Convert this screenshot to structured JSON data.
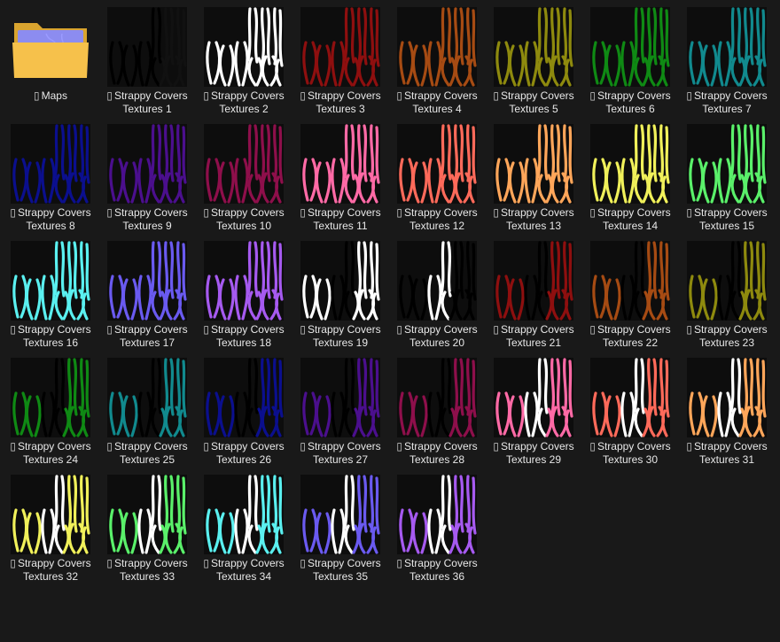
{
  "view": {
    "background": "#191919",
    "text_color": "#e8e8e8"
  },
  "items": [
    {
      "type": "folder",
      "icon": "folder-icon",
      "lines": [
        "Maps"
      ],
      "pin": "▯",
      "colors": {
        "folder": "#f6c14b",
        "paper": "#8c8cf0",
        "accent": "#9b9bff"
      }
    },
    {
      "type": "texture",
      "lines": [
        "Strappy Covers",
        "Textures 1"
      ],
      "pin": "▯",
      "colors": [
        "#000000",
        "#000000",
        "#111111"
      ]
    },
    {
      "type": "texture",
      "lines": [
        "Strappy Covers",
        "Textures 2"
      ],
      "pin": "▯",
      "colors": [
        "#ffffff",
        "#ffffff",
        "#ffffff"
      ]
    },
    {
      "type": "texture",
      "lines": [
        "Strappy Covers",
        "Textures 3"
      ],
      "pin": "▯",
      "colors": [
        "#8e0f0f",
        "#8e0f0f",
        "#8e0f0f"
      ]
    },
    {
      "type": "texture",
      "lines": [
        "Strappy Covers",
        "Textures 4"
      ],
      "pin": "▯",
      "colors": [
        "#a64b13",
        "#a64b13",
        "#a64b13"
      ]
    },
    {
      "type": "texture",
      "lines": [
        "Strappy Covers",
        "Textures 5"
      ],
      "pin": "▯",
      "colors": [
        "#8e8a0e",
        "#8e8a0e",
        "#8e8a0e"
      ]
    },
    {
      "type": "texture",
      "lines": [
        "Strappy Covers",
        "Textures 6"
      ],
      "pin": "▯",
      "colors": [
        "#0f8a14",
        "#0f8a14",
        "#0f8a14"
      ]
    },
    {
      "type": "texture",
      "lines": [
        "Strappy Covers",
        "Textures 7"
      ],
      "pin": "▯",
      "colors": [
        "#118a8e",
        "#118a8e",
        "#118a8e"
      ]
    },
    {
      "type": "texture",
      "lines": [
        "Strappy Covers",
        "Textures 8"
      ],
      "pin": "▯",
      "colors": [
        "#0b0f8e",
        "#0b0f8e",
        "#0b0f8e"
      ]
    },
    {
      "type": "texture",
      "lines": [
        "Strappy Covers",
        "Textures 9"
      ],
      "pin": "▯",
      "colors": [
        "#4b0f8e",
        "#4b0f8e",
        "#4b0f8e"
      ]
    },
    {
      "type": "texture",
      "lines": [
        "Strappy Covers",
        "Textures 10"
      ],
      "pin": "▯",
      "colors": [
        "#8e0f4b",
        "#8e0f4b",
        "#8e0f4b"
      ]
    },
    {
      "type": "texture",
      "lines": [
        "Strappy Covers",
        "Textures 11"
      ],
      "pin": "▯",
      "colors": [
        "#ff6aa6",
        "#ff6aa6",
        "#ff6aa6"
      ]
    },
    {
      "type": "texture",
      "lines": [
        "Strappy Covers",
        "Textures 12"
      ],
      "pin": "▯",
      "colors": [
        "#ff6a5a",
        "#ff6a5a",
        "#ff6a5a"
      ]
    },
    {
      "type": "texture",
      "lines": [
        "Strappy Covers",
        "Textures 13"
      ],
      "pin": "▯",
      "colors": [
        "#ffa65a",
        "#ffa65a",
        "#ffa65a"
      ]
    },
    {
      "type": "texture",
      "lines": [
        "Strappy Covers",
        "Textures 14"
      ],
      "pin": "▯",
      "colors": [
        "#f0f05a",
        "#f0f05a",
        "#f0f05a"
      ]
    },
    {
      "type": "texture",
      "lines": [
        "Strappy Covers",
        "Textures 15"
      ],
      "pin": "▯",
      "colors": [
        "#5af06a",
        "#5af06a",
        "#5af06a"
      ]
    },
    {
      "type": "texture",
      "lines": [
        "Strappy Covers",
        "Textures 16"
      ],
      "pin": "▯",
      "colors": [
        "#5af0f0",
        "#5af0f0",
        "#5af0f0"
      ]
    },
    {
      "type": "texture",
      "lines": [
        "Strappy Covers",
        "Textures 17"
      ],
      "pin": "▯",
      "colors": [
        "#6a5af0",
        "#6a5af0",
        "#6a5af0"
      ]
    },
    {
      "type": "texture",
      "lines": [
        "Strappy Covers",
        "Textures 18"
      ],
      "pin": "▯",
      "colors": [
        "#a65af0",
        "#a65af0",
        "#a65af0"
      ]
    },
    {
      "type": "texture",
      "lines": [
        "Strappy Covers",
        "Textures 19"
      ],
      "pin": "▯",
      "colors": [
        "#ffffff",
        "#000000",
        "#ffffff"
      ]
    },
    {
      "type": "texture",
      "lines": [
        "Strappy Covers",
        "Textures 20"
      ],
      "pin": "▯",
      "colors": [
        "#000000",
        "#ffffff",
        "#000000"
      ]
    },
    {
      "type": "texture",
      "lines": [
        "Strappy Covers",
        "Textures 21"
      ],
      "pin": "▯",
      "colors": [
        "#8e0f0f",
        "#000000",
        "#8e0f0f"
      ]
    },
    {
      "type": "texture",
      "lines": [
        "Strappy Covers",
        "Textures 22"
      ],
      "pin": "▯",
      "colors": [
        "#a64b13",
        "#000000",
        "#a64b13"
      ]
    },
    {
      "type": "texture",
      "lines": [
        "Strappy Covers",
        "Textures 23"
      ],
      "pin": "▯",
      "colors": [
        "#8e8a0e",
        "#000000",
        "#8e8a0e"
      ]
    },
    {
      "type": "texture",
      "lines": [
        "Strappy Covers",
        "Textures 24"
      ],
      "pin": "▯",
      "colors": [
        "#0f8a14",
        "#000000",
        "#0f8a14"
      ]
    },
    {
      "type": "texture",
      "lines": [
        "Strappy Covers",
        "Textures 25"
      ],
      "pin": "▯",
      "colors": [
        "#118a8e",
        "#000000",
        "#118a8e"
      ]
    },
    {
      "type": "texture",
      "lines": [
        "Strappy Covers",
        "Textures 26"
      ],
      "pin": "▯",
      "colors": [
        "#0b0f8e",
        "#000000",
        "#0b0f8e"
      ]
    },
    {
      "type": "texture",
      "lines": [
        "Strappy Covers",
        "Textures 27"
      ],
      "pin": "▯",
      "colors": [
        "#4b0f8e",
        "#000000",
        "#4b0f8e"
      ]
    },
    {
      "type": "texture",
      "lines": [
        "Strappy Covers",
        "Textures 28"
      ],
      "pin": "▯",
      "colors": [
        "#8e0f4b",
        "#000000",
        "#8e0f4b"
      ]
    },
    {
      "type": "texture",
      "lines": [
        "Strappy Covers",
        "Textures 29"
      ],
      "pin": "▯",
      "colors": [
        "#ff6aa6",
        "#ffffff",
        "#ff6aa6"
      ]
    },
    {
      "type": "texture",
      "lines": [
        "Strappy Covers",
        "Textures 30"
      ],
      "pin": "▯",
      "colors": [
        "#ff6a5a",
        "#ffffff",
        "#ff6a5a"
      ]
    },
    {
      "type": "texture",
      "lines": [
        "Strappy Covers",
        "Textures 31"
      ],
      "pin": "▯",
      "colors": [
        "#ffa65a",
        "#ffffff",
        "#ffa65a"
      ]
    },
    {
      "type": "texture",
      "lines": [
        "Strappy Covers",
        "Textures 32"
      ],
      "pin": "▯",
      "colors": [
        "#f0f05a",
        "#ffffff",
        "#f0f05a"
      ]
    },
    {
      "type": "texture",
      "lines": [
        "Strappy Covers",
        "Textures 33"
      ],
      "pin": "▯",
      "colors": [
        "#5af06a",
        "#ffffff",
        "#5af06a"
      ]
    },
    {
      "type": "texture",
      "lines": [
        "Strappy Covers",
        "Textures 34"
      ],
      "pin": "▯",
      "colors": [
        "#5af0f0",
        "#ffffff",
        "#5af0f0"
      ]
    },
    {
      "type": "texture",
      "lines": [
        "Strappy Covers",
        "Textures 35"
      ],
      "pin": "▯",
      "colors": [
        "#6a5af0",
        "#ffffff",
        "#6a5af0"
      ]
    },
    {
      "type": "texture",
      "lines": [
        "Strappy Covers",
        "Textures 36"
      ],
      "pin": "▯",
      "colors": [
        "#a65af0",
        "#ffffff",
        "#a65af0"
      ]
    }
  ]
}
